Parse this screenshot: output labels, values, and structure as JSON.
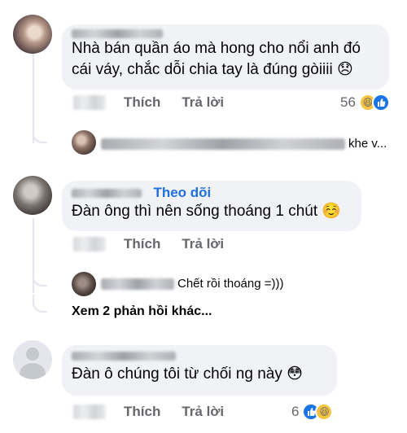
{
  "comments": [
    {
      "text": "Nhà bán quần áo mà hong cho nổi anh đó cái váy, chắc dỗi chia tay là đúng gòiiii 😞",
      "actions": {
        "like": "Thích",
        "reply": "Trả lời"
      },
      "reaction_count": "56",
      "reply": {
        "text": "khe v..."
      }
    },
    {
      "follow_label": "Theo dõi",
      "text": "Đàn ông thì nên sống thoáng 1 chút ☺️",
      "actions": {
        "like": "Thích",
        "reply": "Trả lời"
      },
      "reply": {
        "text": "Chết rồi thoáng =)))"
      },
      "more_replies": "Xem 2 phản hồi khác..."
    },
    {
      "text": "Đàn ô chúng tôi từ chối ng này 😳",
      "actions": {
        "like": "Thích",
        "reply": "Trả lời"
      },
      "reaction_count": "6"
    }
  ],
  "colors": {
    "bubble": "#f0f2f5",
    "secondary_text": "#65676b",
    "link_blue": "#216fdb",
    "like_blue": "#1b74e4",
    "haha_yellow": "#f7c441"
  },
  "icons": [
    "haha-reaction-icon",
    "like-reaction-icon"
  ]
}
